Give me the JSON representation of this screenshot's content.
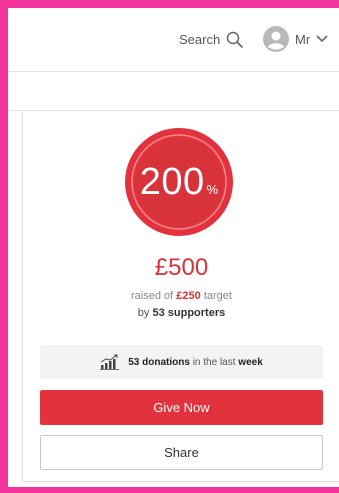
{
  "header": {
    "search_label": "Search",
    "search_icon": "search-icon",
    "user_icon": "avatar-icon",
    "user_name": "Mr",
    "user_menu_icon": "chevron-down-icon"
  },
  "fundraiser": {
    "percent_value": "200",
    "percent_sign": "%",
    "percent_fraction": 2.0,
    "raised_amount": "£500",
    "raised_prefix": "raised of",
    "target_amount": "£250",
    "target_suffix": "target",
    "supporters_prefix": "by",
    "supporters_count": "53 supporters",
    "stats_icon": "chart-growth-icon",
    "donations_count": "53 donations",
    "donations_middle": "in the last",
    "donations_period": "week"
  },
  "actions": {
    "give_label": "Give Now",
    "share_label": "Share"
  },
  "colors": {
    "frame": "#f2339b",
    "brand_red": "#e1323d",
    "ring_red": "#d8323a"
  }
}
